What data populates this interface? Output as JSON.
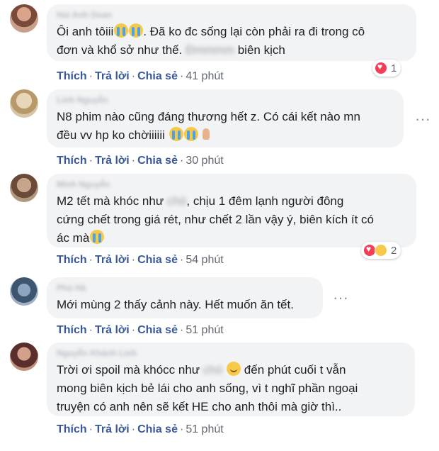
{
  "comments": [
    {
      "author": "Hai Anh Doan",
      "line1": "Ôi anh tôiii",
      "line1_after": ". Đã ko đc sống lại còn phải ra đi trong cô",
      "line2": "đơn và khổ sở như thế.",
      "line2_blur": "Đmmmm",
      "line2_after": " biên kịch",
      "like": "Thích",
      "reply": "Trả lời",
      "share": "Chia sẻ",
      "time": "41 phút",
      "reaction_count": "1",
      "emojis": [
        "loudly-crying-face",
        "loudly-crying-face"
      ],
      "reactions": [
        "love-reaction"
      ]
    },
    {
      "author": "Linh Nguyễn",
      "line1": "N8 phim nào cũng đáng thương hết z. Có cái kết nào mn",
      "line2": "đều vv hp ko chờiiiiii ",
      "like": "Thích",
      "reply": "Trả lời",
      "share": "Chia sẻ",
      "time": "30 phút",
      "emojis": [
        "loudly-crying-face",
        "loudly-crying-face",
        "folded-hands"
      ]
    },
    {
      "author": "Minh Nguyễn",
      "line1": "M2 tết mà khóc như",
      "line1_blur": "chó",
      "line1_after": ", chịu 1 đêm lạnh người đông",
      "line2": "cứng chết trong giá rét, như chết 2 lần vậy ý, biên kích ít có",
      "line3": "ác mà",
      "like": "Thích",
      "reply": "Trả lời",
      "share": "Chia sẻ",
      "time": "54 phút",
      "reaction_count": "2",
      "emojis": [
        "loudly-crying-face"
      ],
      "reactions": [
        "love-reaction",
        "sad-reaction"
      ]
    },
    {
      "author": "Phú Hà",
      "line1": "Mới mùng 2 thấy cảnh này. Hết muốn ăn tết.",
      "like": "Thích",
      "reply": "Trả lời",
      "share": "Chia sẻ",
      "time": "51 phút"
    },
    {
      "author": "Nguyễn Khánh Linh",
      "line1": "Trời ơi spoil mà khócc như",
      "line1_blur": "chó",
      "line1_after": " đến phút cuối t vẫn",
      "line2": "mong biên kịch bẻ lái cho anh sống, vì t nghĩ phần ngoại",
      "line3": "truyện có anh nên sẽ kết HE cho anh thôi mà giờ thì..",
      "like": "Thích",
      "reply": "Trả lời",
      "share": "Chia sẻ",
      "time": "51 phút",
      "emojis": [
        "smiling-face"
      ]
    }
  ],
  "separator": "·",
  "more_glyph": "···",
  "colors": {
    "action_blue": "#385898",
    "bubble_bg": "#f2f3f5",
    "meta_gray": "#606770"
  }
}
